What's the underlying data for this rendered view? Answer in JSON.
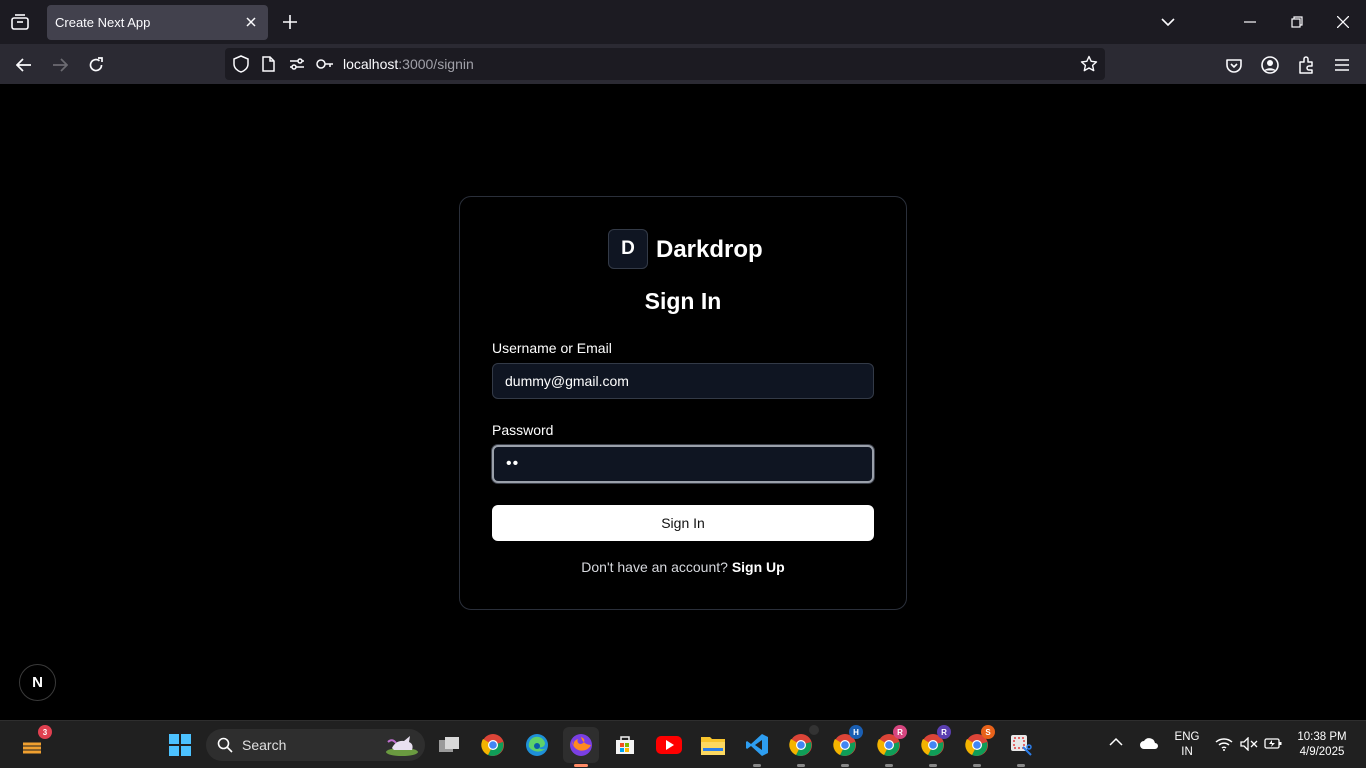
{
  "browser": {
    "tab_title": "Create Next App",
    "url_host": "localhost",
    "url_path": ":3000/signin"
  },
  "page": {
    "logo_letter": "D",
    "brand_name": "Darkdrop",
    "heading": "Sign In",
    "username_label": "Username or Email",
    "username_value": "dummy@gmail.com",
    "password_label": "Password",
    "password_value": "••",
    "signin_button": "Sign In",
    "footer_prompt": "Don't have an account? ",
    "footer_link": "Sign Up",
    "next_badge": "N"
  },
  "taskbar": {
    "widgets_badge": "3",
    "search_label": "Search",
    "lang_line1": "ENG",
    "lang_line2": "IN",
    "time": "10:38 PM",
    "date": "4/9/2025",
    "chrome_badges": [
      "",
      "H",
      "R",
      "R",
      "S"
    ]
  },
  "colors": {
    "page_bg": "#000000",
    "card_border": "#2a2f3a",
    "input_bg": "#0f1522",
    "button_bg": "#ffffff"
  }
}
